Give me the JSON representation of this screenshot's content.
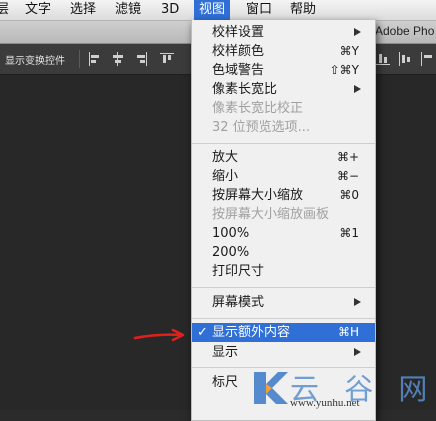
{
  "menubar": {
    "items": [
      "层",
      "文字",
      "选择",
      "滤镜",
      "3D",
      "视图",
      "窗口",
      "帮助"
    ]
  },
  "window": {
    "title": "Adobe Pho"
  },
  "options_bar": {
    "show_transform_label": "显示变换控件"
  },
  "view_menu": {
    "items": [
      {
        "label": "校样设置",
        "submenu": true
      },
      {
        "label": "校样颜色",
        "shortcut": "⌘Y"
      },
      {
        "label": "色域警告",
        "shortcut": "⇧⌘Y"
      },
      {
        "label": "像素长宽比",
        "submenu": true
      },
      {
        "label": "像素长宽比校正",
        "disabled": true
      },
      {
        "label": "32 位预览选项...",
        "disabled": true
      },
      {
        "label": "放大",
        "shortcut": "⌘+"
      },
      {
        "label": "缩小",
        "shortcut": "⌘−"
      },
      {
        "label": "按屏幕大小缩放",
        "shortcut": "⌘0"
      },
      {
        "label": "按屏幕大小缩放画板",
        "disabled": true
      },
      {
        "label": "100%",
        "shortcut": "⌘1"
      },
      {
        "label": "200%"
      },
      {
        "label": "打印尺寸"
      },
      {
        "label": "屏幕模式",
        "submenu": true
      },
      {
        "label": "显示额外内容",
        "shortcut": "⌘H",
        "checked": true,
        "highlighted": true
      },
      {
        "label": "显示",
        "submenu": true
      },
      {
        "label": "标尺"
      }
    ],
    "check_mark": "✓"
  },
  "watermark": {
    "text": "云 谷 网",
    "url": "www.yunhu.net"
  },
  "colors": {
    "accent": "#2f6fd6",
    "arrow": "#e0201b"
  }
}
